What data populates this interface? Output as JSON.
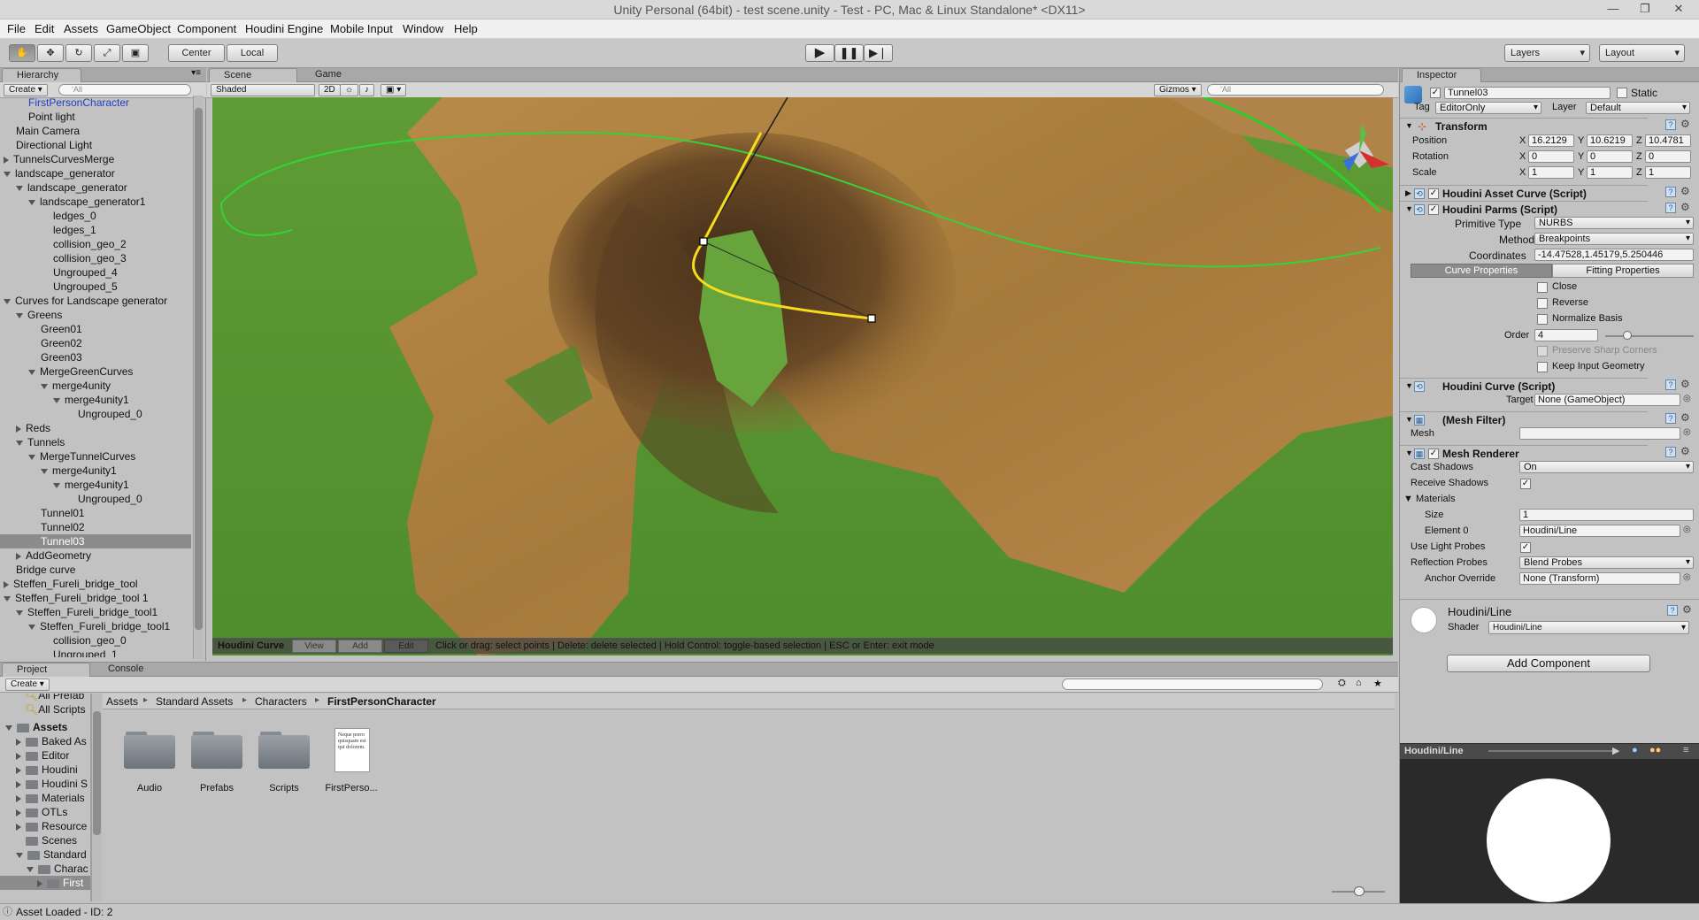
{
  "window": {
    "title": "Unity Personal (64bit) - test scene.unity - Test - PC, Mac & Linux Standalone* <DX11>"
  },
  "menu": [
    "File",
    "Edit",
    "Assets",
    "GameObject",
    "Component",
    "Houdini Engine",
    "Mobile Input",
    "Window",
    "Help"
  ],
  "toolbar": {
    "pivot": "Center",
    "space": "Local",
    "layers": "Layers",
    "layout": "Layout"
  },
  "hierarchy": {
    "tab": "Hierarchy",
    "create": "Create",
    "search": "‘All",
    "rows": [
      {
        "label": "FirstPersonCharacter",
        "indent": 2,
        "tri": "",
        "color": "#1f3fc4"
      },
      {
        "label": "Point light",
        "indent": 2,
        "tri": ""
      },
      {
        "label": "Main Camera",
        "indent": 1,
        "tri": ""
      },
      {
        "label": "Directional Light",
        "indent": 1,
        "tri": ""
      },
      {
        "label": "TunnelsCurvesMerge",
        "indent": 0,
        "tri": "closed"
      },
      {
        "label": "landscape_generator",
        "indent": 0,
        "tri": "open"
      },
      {
        "label": "landscape_generator",
        "indent": 1,
        "tri": "open"
      },
      {
        "label": "landscape_generator1",
        "indent": 2,
        "tri": "open"
      },
      {
        "label": "ledges_0",
        "indent": 4,
        "tri": ""
      },
      {
        "label": "ledges_1",
        "indent": 4,
        "tri": ""
      },
      {
        "label": "collision_geo_2",
        "indent": 4,
        "tri": ""
      },
      {
        "label": "collision_geo_3",
        "indent": 4,
        "tri": ""
      },
      {
        "label": "Ungrouped_4",
        "indent": 4,
        "tri": ""
      },
      {
        "label": "Ungrouped_5",
        "indent": 4,
        "tri": ""
      },
      {
        "label": "Curves for Landscape generator",
        "indent": 0,
        "tri": "open"
      },
      {
        "label": "Greens",
        "indent": 1,
        "tri": "open"
      },
      {
        "label": "Green01",
        "indent": 3,
        "tri": ""
      },
      {
        "label": "Green02",
        "indent": 3,
        "tri": ""
      },
      {
        "label": "Green03",
        "indent": 3,
        "tri": ""
      },
      {
        "label": "MergeGreenCurves",
        "indent": 2,
        "tri": "open"
      },
      {
        "label": "merge4unity",
        "indent": 3,
        "tri": "open"
      },
      {
        "label": "merge4unity1",
        "indent": 4,
        "tri": "open"
      },
      {
        "label": "Ungrouped_0",
        "indent": 6,
        "tri": ""
      },
      {
        "label": "Reds",
        "indent": 1,
        "tri": "closed"
      },
      {
        "label": "Tunnels",
        "indent": 1,
        "tri": "open"
      },
      {
        "label": "MergeTunnelCurves",
        "indent": 2,
        "tri": "open"
      },
      {
        "label": "merge4unity1",
        "indent": 3,
        "tri": "open"
      },
      {
        "label": "merge4unity1",
        "indent": 4,
        "tri": "open"
      },
      {
        "label": "Ungrouped_0",
        "indent": 6,
        "tri": ""
      },
      {
        "label": "Tunnel01",
        "indent": 3,
        "tri": ""
      },
      {
        "label": "Tunnel02",
        "indent": 3,
        "tri": ""
      },
      {
        "label": "Tunnel03",
        "indent": 3,
        "tri": "",
        "selected": true
      },
      {
        "label": "AddGeometry",
        "indent": 1,
        "tri": "closed"
      },
      {
        "label": "Bridge curve",
        "indent": 1,
        "tri": ""
      },
      {
        "label": "Steffen_Fureli_bridge_tool",
        "indent": 0,
        "tri": "closed"
      },
      {
        "label": "Steffen_Fureli_bridge_tool 1",
        "indent": 0,
        "tri": "open"
      },
      {
        "label": "Steffen_Fureli_bridge_tool1",
        "indent": 1,
        "tri": "open"
      },
      {
        "label": "Steffen_Fureli_bridge_tool1",
        "indent": 2,
        "tri": "open"
      },
      {
        "label": "collision_geo_0",
        "indent": 4,
        "tri": ""
      },
      {
        "label": "Ungrouped_1",
        "indent": 4,
        "tri": ""
      }
    ]
  },
  "scene": {
    "tabs": [
      "Scene",
      "Game"
    ],
    "shading": "Shaded",
    "mode2d": "2D",
    "gizmos": "Gizmos",
    "search": "‘All",
    "bottom_bar": {
      "title": "Houdini Curve",
      "modes": [
        "View",
        "Add",
        "Edit"
      ],
      "hint": "Click or drag: select points | Delete: delete selected | Hold Control: toggle-based selection | ESC or Enter: exit mode"
    }
  },
  "inspector": {
    "tab": "Inspector",
    "object_name": "Tunnel03",
    "static_label": "Static",
    "tag_label": "Tag",
    "tag_value": "EditorOnly",
    "layer_label": "Layer",
    "layer_value": "Default",
    "transform": {
      "title": "Transform",
      "rows": [
        {
          "label": "Position",
          "x": "16.2129",
          "y": "10.6219",
          "z": "10.4781"
        },
        {
          "label": "Rotation",
          "x": "0",
          "y": "0",
          "z": "0"
        },
        {
          "label": "Scale",
          "x": "1",
          "y": "1",
          "z": "1"
        }
      ]
    },
    "asset_curve_title": "Houdini Asset Curve (Script)",
    "parms": {
      "title": "Houdini Parms (Script)",
      "primitive_type_label": "Primitive Type",
      "primitive_type": "NURBS",
      "method_label": "Method",
      "method": "Breakpoints",
      "coordinates_label": "Coordinates",
      "coordinates": "-14.47528,1.45179,5.250446",
      "tab_curve": "Curve Properties",
      "tab_fitting": "Fitting Properties",
      "close": "Close",
      "reverse": "Reverse",
      "normalize": "Normalize Basis",
      "order_label": "Order",
      "order": "4",
      "preserve": "Preserve Sharp Corners",
      "keep_input": "Keep Input Geometry"
    },
    "houdini_curve": {
      "title": "Houdini Curve (Script)",
      "target_label": "Target",
      "target_value": "None (GameObject)"
    },
    "mesh_filter": {
      "title": "(Mesh Filter)",
      "mesh_label": "Mesh"
    },
    "mesh_renderer": {
      "title": "Mesh Renderer",
      "cast_shadows_label": "Cast Shadows",
      "cast_shadows": "On",
      "receive_shadows_label": "Receive Shadows",
      "materials_label": "Materials",
      "size_label": "Size",
      "size": "1",
      "element0_label": "Element 0",
      "element0": "Houdini/Line",
      "light_probes_label": "Use Light Probes",
      "reflection_probes_label": "Reflection Probes",
      "reflection_probes": "Blend Probes",
      "anchor_label": "Anchor Override",
      "anchor_value": "None (Transform)"
    },
    "material": {
      "name": "Houdini/Line",
      "shader_label": "Shader",
      "shader_value": "Houdini/Line"
    },
    "add_component": "Add Component",
    "preview_title": "Houdini/Line"
  },
  "project": {
    "tabs": [
      "Project",
      "Console"
    ],
    "create": "Create",
    "favorites": [
      "All Prefab",
      "All Scripts"
    ],
    "tree": [
      {
        "label": "Assets",
        "indent": 0,
        "tri": "open",
        "bold": true
      },
      {
        "label": "Baked As",
        "indent": 1,
        "tri": "closed"
      },
      {
        "label": "Editor",
        "indent": 1,
        "tri": "closed"
      },
      {
        "label": "Houdini",
        "indent": 1,
        "tri": "closed"
      },
      {
        "label": "Houdini S",
        "indent": 1,
        "tri": "closed"
      },
      {
        "label": "Materials",
        "indent": 1,
        "tri": "closed"
      },
      {
        "label": "OTLs",
        "indent": 1,
        "tri": "closed"
      },
      {
        "label": "Resource",
        "indent": 1,
        "tri": "closed"
      },
      {
        "label": "Scenes",
        "indent": 1,
        "tri": ""
      },
      {
        "label": "Standard",
        "indent": 1,
        "tri": "open"
      },
      {
        "label": "Charac",
        "indent": 2,
        "tri": "open"
      },
      {
        "label": "First",
        "indent": 3,
        "tri": "closed",
        "selected": true
      }
    ],
    "breadcrumb": [
      "Assets",
      "Standard Assets",
      "Characters",
      "FirstPersonCharacter"
    ],
    "items": [
      {
        "label": "Audio",
        "type": "folder"
      },
      {
        "label": "Prefabs",
        "type": "folder"
      },
      {
        "label": "Scripts",
        "type": "folder"
      },
      {
        "label": "FirstPerso...",
        "type": "file",
        "preview": "Neque porro quisquam est qui dolorem."
      }
    ]
  },
  "status": {
    "text": "Asset Loaded - ID: 2"
  },
  "colors": {
    "panel_bg": "#c2c2c2",
    "selection": "#8c8c8c",
    "curve_yellow": "#f5dc1e",
    "green_outline": "#35d23a",
    "dirt": "#a87a3c",
    "grass": "#5a9a34"
  }
}
